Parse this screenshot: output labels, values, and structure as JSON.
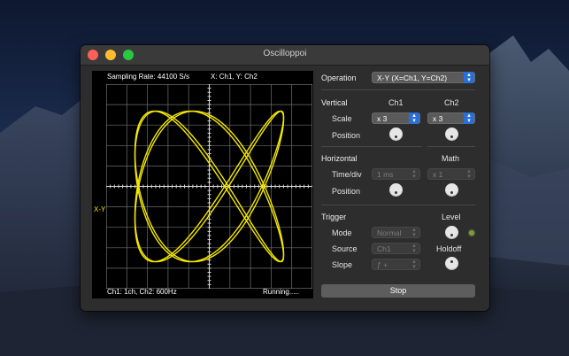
{
  "window": {
    "title": "Oscilloppoi"
  },
  "scope": {
    "sampling_rate": "Sampling Rate: 44100 S/s",
    "mode_label": "X: Ch1,  Y: Ch2",
    "trace_label": "X-Y",
    "channel_info": "Ch1: 1ch, Ch2: 600Hz",
    "status": "Running.....",
    "trace_color": "#f5e900"
  },
  "operation": {
    "label": "Operation",
    "value": "X-Y (X=Ch1, Y=Ch2)"
  },
  "vertical": {
    "label": "Vertical",
    "ch1": "Ch1",
    "ch2": "Ch2",
    "scale_label": "Scale",
    "ch1_scale": "x 3",
    "ch2_scale": "x 3",
    "position_label": "Position"
  },
  "horizontal": {
    "label": "Horizontal",
    "math": "Math",
    "timediv_label": "Time/div",
    "timediv_value": "1 ms",
    "math_value": "x 1",
    "position_label": "Position"
  },
  "trigger": {
    "label": "Trigger",
    "level": "Level",
    "mode_label": "Mode",
    "mode_value": "Normal",
    "source_label": "Source",
    "source_value": "Ch1",
    "slope_label": "Slope",
    "slope_value": "ƒ +",
    "holdoff": "Holdoff"
  },
  "stop_button": "Stop",
  "colors": {
    "accent": "#2a6fd6",
    "trace": "#f5e900",
    "led": "#7e9a3c"
  }
}
